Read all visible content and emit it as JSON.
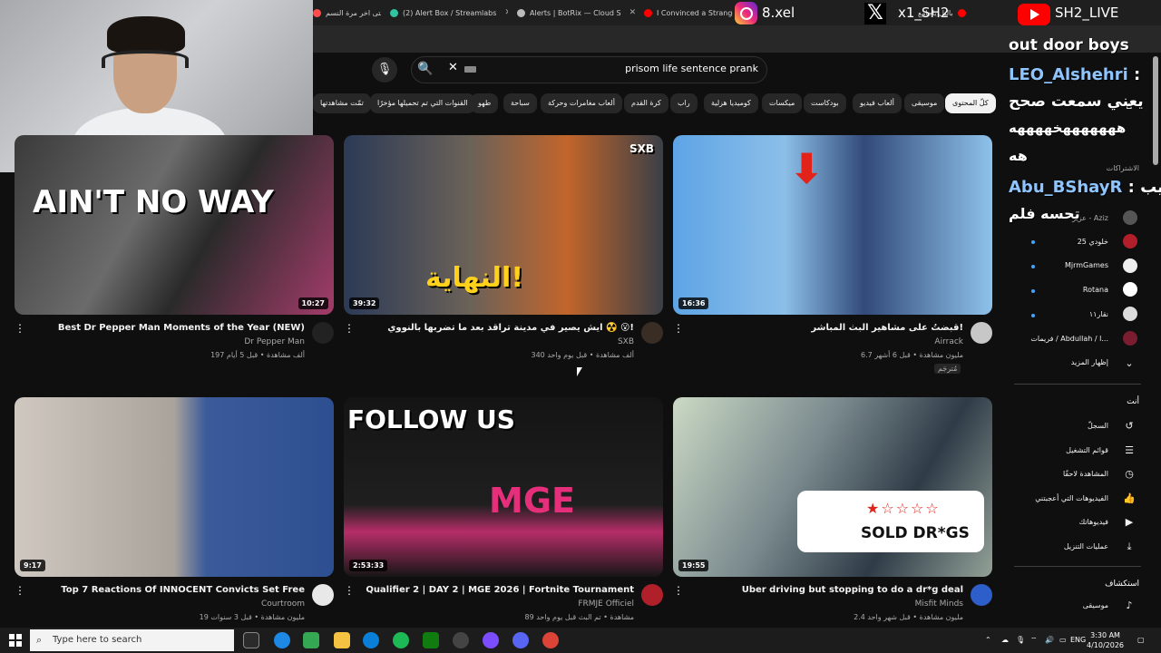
{
  "browser": {
    "tabs": [
      {
        "label": "متى اخر مرة النسم"
      },
      {
        "label": "(2) Alert Box / Streamlabs"
      },
      {
        "label": "Alerts | BotRix — Cloud S"
      },
      {
        "label": "I Convinced a Stranger"
      },
      {
        "label": "باليل ياجامع"
      }
    ]
  },
  "overlay": {
    "instagram_handle": "8.xel",
    "x_handle": "x1_SH2",
    "youtube_handle": "SH2_LIVE",
    "chat": [
      {
        "text": "out door boys"
      },
      {
        "user": "LEO_Alshehri",
        "sep": ":"
      },
      {
        "text": "يعني سمعت صحح"
      },
      {
        "text": "هههههههخههههه"
      },
      {
        "text": "هه"
      },
      {
        "user": "Abu_BShayR",
        "sep": ":",
        "msg": "يب"
      },
      {
        "text": "تحسه فلم"
      }
    ]
  },
  "search": {
    "query": "prisom life sentence prank"
  },
  "chips": [
    {
      "label": "كلّ المحتوى",
      "active": true
    },
    {
      "label": "موسيقى"
    },
    {
      "label": "ألعاب فيديو"
    },
    {
      "label": "بودكاست"
    },
    {
      "label": "ميكسات"
    },
    {
      "label": "كوميديا هزلية"
    },
    {
      "label": "راب"
    },
    {
      "label": "كرة القدم"
    },
    {
      "label": "ألعاب مغامرات وحركة"
    },
    {
      "label": "سباحة"
    },
    {
      "label": "طهو"
    },
    {
      "label": "القنوات التي تم تحميلها مؤخرًا"
    },
    {
      "label": "تمّت مشاهدتها"
    }
  ],
  "videos": [
    {
      "title": "Best Dr Pepper Man Moments of the Year (NEW)",
      "channel": "Dr Pepper Man",
      "meta": "197 ألف مشاهدة • قبل 5 أيام",
      "duration": "10:27",
      "thumb_text": "AIN'T NO WAY"
    },
    {
      "title": "ايش يصير في مدينة تراقد بعد ما تضربها بالنووي ☢️ 😮!",
      "channel": "SXB",
      "meta": "340 ألف مشاهدة • قبل يوم واحد",
      "duration": "39:32",
      "thumb_text": "النهاية!",
      "thumb_brand": "SXB"
    },
    {
      "title": "قبضتُ على مشاهير البث المباشر!",
      "channel": "Airrack",
      "meta": "6.7 مليون مشاهدة • قبل 6 أشهر",
      "duration": "16:36",
      "badge": "مُترجَم"
    },
    {
      "title": "Top 7 Reactions Of INNOCENT Convicts Set Free",
      "channel": "Courtroom",
      "meta": "19 مليون مشاهدة • قبل 3 سنوات",
      "duration": "9:17"
    },
    {
      "title": "Qualifier 2 | DAY 2 | MGE 2026 | Fortnite Tournament",
      "channel": "FRMJE Officiel",
      "meta": "89 مشاهدة • تم البث قبل يوم واحد",
      "duration": "2:53:33",
      "thumb_text": "FOLLOW US",
      "thumb_brand": "MGE"
    },
    {
      "title": "Uber driving but stopping to do a dr*g deal",
      "channel": "Misfit Minds",
      "meta": "2.4 مليون مشاهدة • قبل شهر واحد",
      "duration": "19:55",
      "thumb_text": "SOLD DR*GS"
    }
  ],
  "sidebar": {
    "subscriptions_header": "الاشتراكات",
    "subs": [
      {
        "name": "عزيز - Aziz"
      },
      {
        "name": "خلودي 25"
      },
      {
        "name": "MjrmGames"
      },
      {
        "name": "Rotana"
      },
      {
        "name": "نقار١١"
      },
      {
        "name": "فريمات / Abdullah / ا..."
      },
      {
        "name": "إظهار المزيد"
      }
    ],
    "you_header": "أنت",
    "you_items": [
      {
        "label": "السجلّ"
      },
      {
        "label": "قوائم التشغيل"
      },
      {
        "label": "المشاهدة لاحقًا"
      },
      {
        "label": "الفيديوهات التي أعجبتني"
      },
      {
        "label": "فيديوهاتك"
      },
      {
        "label": "عمليات التنزيل"
      }
    ],
    "explore_header": "استكشاف",
    "explore_items": [
      {
        "label": "موسيقى"
      }
    ]
  },
  "taskbar": {
    "search_placeholder": "Type here to search",
    "lang": "ENG",
    "time": "3:30 AM",
    "date": "4/10/2026"
  }
}
